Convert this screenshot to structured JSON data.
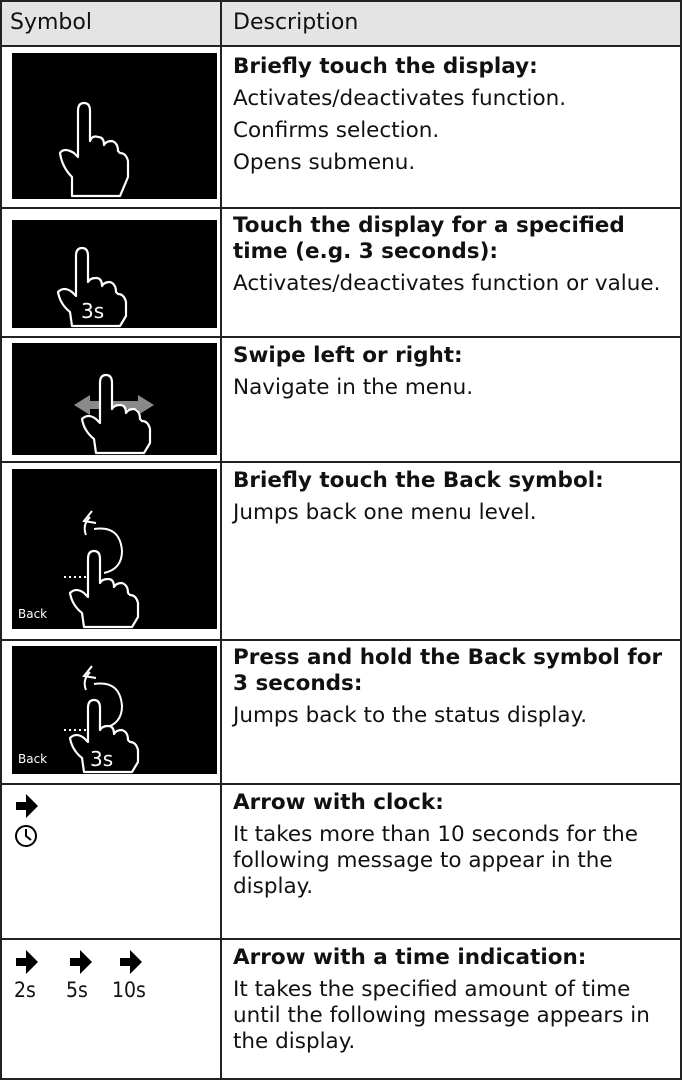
{
  "header": {
    "symbol": "Symbol",
    "description": "Description"
  },
  "rows": [
    {
      "title": "Briefly touch the display:",
      "lines": [
        "Activates/deactivates function.",
        "Confirms selection.",
        "Opens submenu."
      ]
    },
    {
      "title": "Touch the display for a specified time (e.g. 3 seconds):",
      "lines": [
        "Activates/deactivates function or value."
      ]
    },
    {
      "title": "Swipe left or right:",
      "lines": [
        "Navigate in the menu."
      ]
    },
    {
      "title": "Briefly touch the Back symbol:",
      "lines": [
        "Jumps back one menu level."
      ]
    },
    {
      "title": "Press and hold the Back symbol for 3 seconds:",
      "lines": [
        "Jumps back to the status display."
      ]
    },
    {
      "title": "Arrow with clock:",
      "lines": [
        "It takes more than 10 seconds for the following message to appear in the display."
      ]
    },
    {
      "title": "Arrow with a time indication:",
      "lines": [
        "It takes the specified amount of time until the following message appears in the display."
      ]
    }
  ],
  "icons": {
    "hold_label": "3s",
    "back_label": "Back",
    "time_labels": [
      "2s",
      "5s",
      "10s"
    ]
  }
}
